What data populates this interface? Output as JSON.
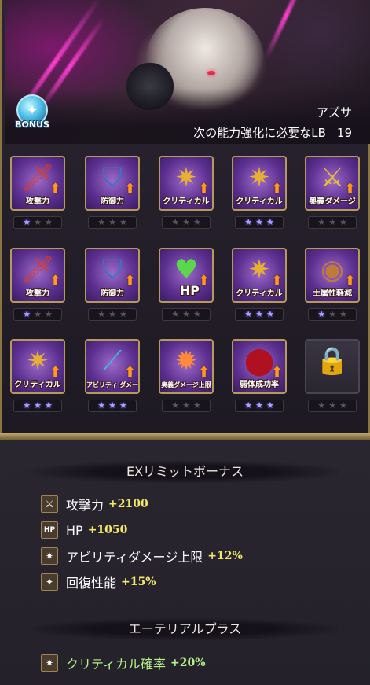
{
  "character": {
    "name": "アズサ",
    "lb_label": "次の能力強化に必要なLB",
    "lb_value": "19",
    "bonus_badge": "BONUS"
  },
  "skills": [
    {
      "label": "攻撃力",
      "glyph": "🗡",
      "stars": 1,
      "color": "#d83a2a"
    },
    {
      "label": "防御力",
      "glyph": "⛉",
      "stars": 0,
      "color": "#2a7acc"
    },
    {
      "label": "クリティカル",
      "glyph": "✷",
      "stars": 0,
      "color": "#e8b030"
    },
    {
      "label": "クリティカル",
      "glyph": "✷",
      "stars": 3,
      "color": "#e8b030"
    },
    {
      "label": "奥義ダメージ",
      "glyph": "⚔",
      "stars": 0,
      "color": "#e8c030"
    },
    {
      "label": "攻撃力",
      "glyph": "🗡",
      "stars": 1,
      "color": "#d83a2a"
    },
    {
      "label": "防御力",
      "glyph": "⛉",
      "stars": 0,
      "color": "#2a7acc"
    },
    {
      "label": "HP",
      "glyph": "♥",
      "stars": 0,
      "color": "#5ad84a"
    },
    {
      "label": "クリティカル",
      "glyph": "✷",
      "stars": 3,
      "color": "#e8b030"
    },
    {
      "label": "土属性軽減",
      "glyph": "◉",
      "stars": 1,
      "color": "#c07a3a"
    },
    {
      "label": "クリティカル",
      "glyph": "✷",
      "stars": 3,
      "color": "#e8b030"
    },
    {
      "label": "アビリティ ダメージ上限",
      "glyph": "⟋",
      "stars": 3,
      "color": "#3ab8e8"
    },
    {
      "label": "奥義ダメージ上限",
      "glyph": "✹",
      "stars": 0,
      "color": "#ff8a3a"
    },
    {
      "label": "弱体成功率",
      "glyph": "⬤",
      "stars": 3,
      "color": "#b01020"
    },
    {
      "label": "",
      "glyph": "🔒",
      "stars": 0,
      "locked": true
    }
  ],
  "ex_limit": {
    "title": "EXリミットボーナス",
    "items": [
      {
        "icon": "⚔",
        "name": "攻撃力",
        "value": "+2100"
      },
      {
        "icon": "HP",
        "name": "HP",
        "value": "+1050"
      },
      {
        "icon": "✷",
        "name": "アビリティダメージ上限",
        "value": "+12%"
      },
      {
        "icon": "✦",
        "name": "回復性能",
        "value": "+15%"
      }
    ]
  },
  "ethereal": {
    "title": "エーテリアルプラス",
    "items": [
      {
        "icon": "✷",
        "name": "クリティカル確率",
        "value": "+20%"
      }
    ]
  }
}
